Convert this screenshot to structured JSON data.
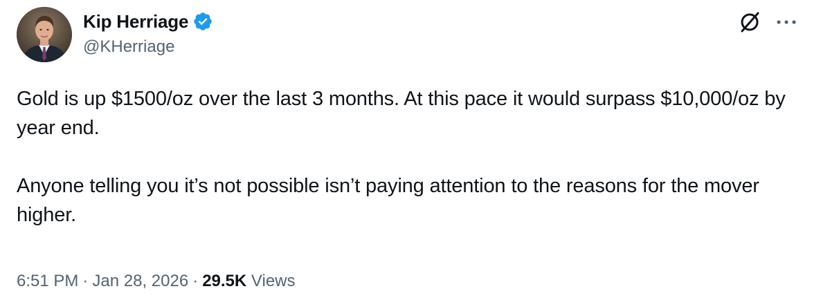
{
  "author": {
    "display_name": "Kip Herriage",
    "handle": "@KHerriage",
    "verified": true,
    "verified_color": "#1d9bf0"
  },
  "icons": {
    "avatar": "profile-photo",
    "verified": "verified-badge-icon",
    "grok": "grok-icon",
    "more": "more-options-icon"
  },
  "tweet": {
    "paragraphs": [
      "Gold is up $1500/oz over the last 3 months. At this pace it would surpass $10,000/oz by year end.",
      "Anyone telling you it’s not possible isn’t paying attention to the reasons for the mover higher."
    ]
  },
  "meta": {
    "time": "6:51 PM",
    "separator": "·",
    "date": "Jan 28, 2026",
    "views_count": "29.5K",
    "views_label": "Views"
  },
  "colors": {
    "text": "#0f1419",
    "secondary": "#536471",
    "background": "#ffffff"
  }
}
